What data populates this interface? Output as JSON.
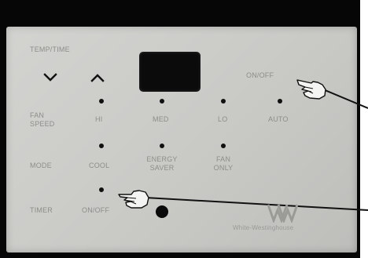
{
  "panel": {
    "temp_time_label": "TEMP/TIME",
    "onoff_power_label": "ON/OFF",
    "row_labels": {
      "fan_speed": "FAN\nSPEED",
      "mode": "MODE",
      "timer": "TIMER"
    },
    "fan_speed_options": [
      "HI",
      "MED",
      "LO",
      "AUTO"
    ],
    "mode_options": [
      "COOL",
      "ENERGY\nSAVER",
      "FAN\nONLY"
    ],
    "timer_option": "ON/OFF",
    "brand": "White-Westinghouse"
  },
  "icons": {
    "temp_down": "chevron-down-icon",
    "temp_up": "chevron-up-icon",
    "pointer_power": "pointing-hand-icon",
    "pointer_timer": "pointing-hand-icon",
    "logo": "ww-logo-icon"
  },
  "colors": {
    "panel_face": "#c9c9c6",
    "label_text": "#8d8d8a",
    "indicator": "#101010",
    "display": "#0b0b0b",
    "frame": "#060606"
  }
}
